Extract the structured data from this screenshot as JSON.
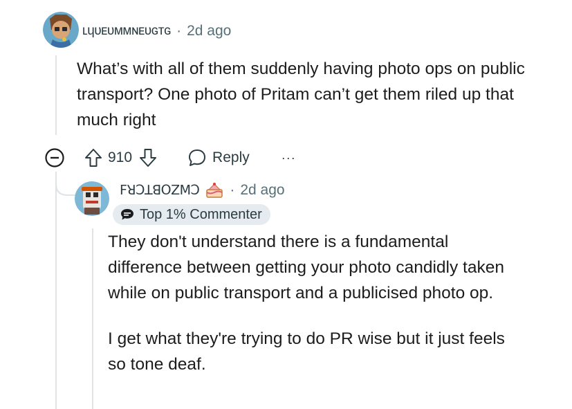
{
  "comment": {
    "username": "ʟɥᴜᴇᴜᴍᴍɴᴇᴜɢᴛɢ",
    "time": "2d ago",
    "text": "What’s with all of them suddenly having photo ops on public transport? One photo of Pritam can’t get them riled up that much right",
    "votes": "910",
    "reply_label": "Reply",
    "more_label": "···"
  },
  "reply": {
    "username": "ꓝꓤꓛꓕꓭꓳꓜꓟꓛ",
    "time": "2d ago",
    "badge": "Top 1% Commenter",
    "paragraphs": [
      "They don't understand there is a fundamental difference between getting your photo candidly taken while on public transport and a publicised photo op.",
      "I get what they're trying to do PR wise but it just feels so tone deaf."
    ]
  },
  "colors": {
    "text": "#1c1c1e",
    "meta": "#576f76",
    "thread_line": "#dfe3e6",
    "badge_bg": "#e5ebee"
  },
  "icons": [
    "collapse-icon",
    "upvote-icon",
    "downvote-icon",
    "reply-icon",
    "more-icon",
    "cake-icon",
    "commenter-badge-icon"
  ]
}
